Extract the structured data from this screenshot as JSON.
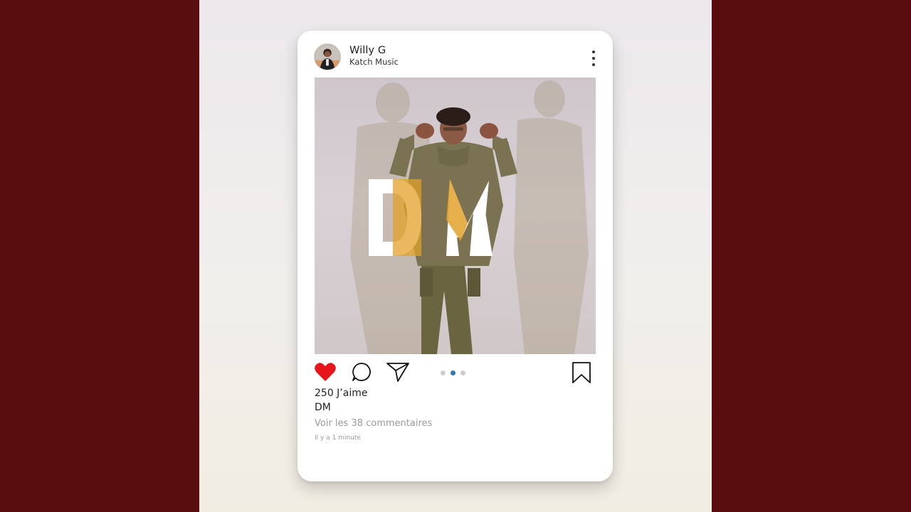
{
  "post": {
    "username": "Willy G",
    "subtitle": "Katch Music",
    "image_overlay_text": "DM",
    "likes_text": "250 J’aime",
    "caption": "DM",
    "comments_link": "Voir les 38 commentaires",
    "timestamp": "Il y a 1 minute"
  },
  "carousel": {
    "total": 3,
    "active_index": 1
  },
  "actions": {
    "like_icon": "heart-icon",
    "comment_icon": "comment-icon",
    "share_icon": "send-icon",
    "save_icon": "bookmark-icon",
    "more_icon": "more-vertical-icon",
    "liked": true
  },
  "colors": {
    "background": "#5a0d0e",
    "heart": "#e8141c",
    "active_dot": "#2c7bb6",
    "logo_accent": "#e3a12a"
  }
}
